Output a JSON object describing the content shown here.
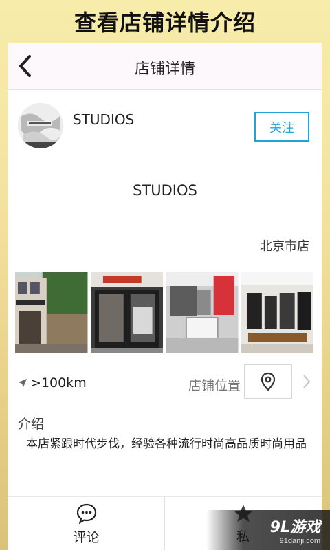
{
  "banner": {
    "title": "查看店铺详情介绍"
  },
  "header": {
    "title": "店铺详情"
  },
  "shop": {
    "name": "STUDIOS",
    "center_name": "STUDIOS",
    "city": "北京市店",
    "follow_label": "关注"
  },
  "info": {
    "distance": ">100km",
    "location_label": "店铺位置",
    "intro_title": "介绍",
    "intro_text": "本店紧跟时代步伐，经验各种流行时尚高品质时尚用品"
  },
  "tabs": {
    "comment_label": "评论",
    "private_label": "私"
  },
  "watermark": {
    "main": "9L游戏",
    "sub": "91danji.com"
  },
  "colors": {
    "accent": "#1fa5d9",
    "banner_bg": "#f6eaa8"
  }
}
